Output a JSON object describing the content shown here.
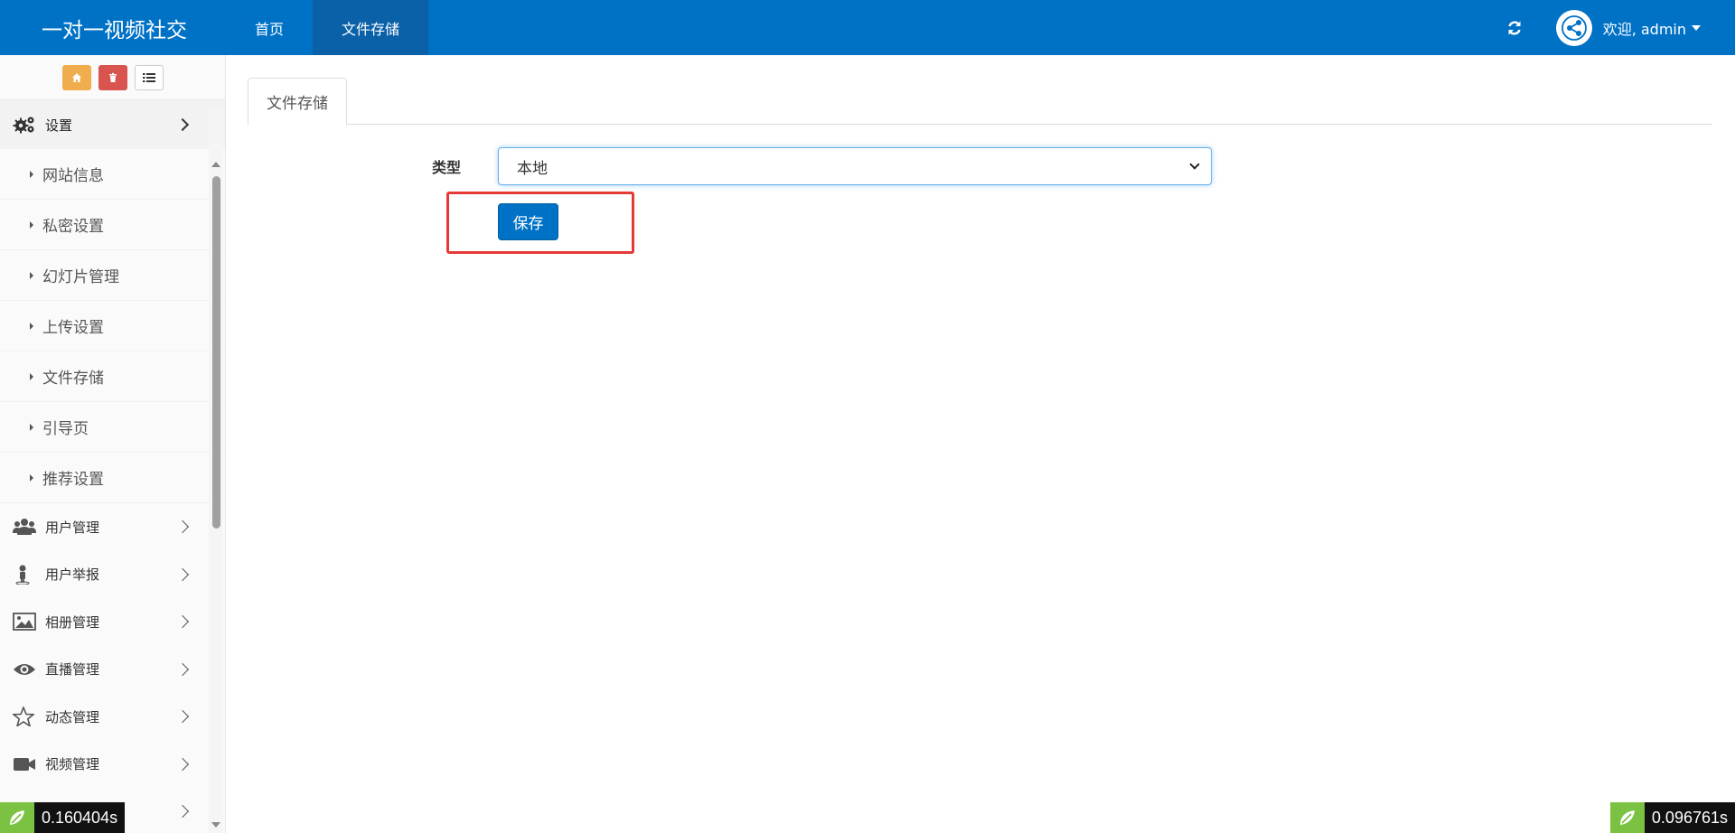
{
  "navbar": {
    "brand": "一对一视频社交",
    "tabs": [
      {
        "label": "首页",
        "active": false
      },
      {
        "label": "文件存储",
        "active": true
      }
    ],
    "refresh_icon": "refresh-icon",
    "user_avatar_icon": "share-network-icon",
    "user_greeting": "欢迎, admin",
    "color": "#0072c6"
  },
  "sidebar": {
    "shortcuts": [
      {
        "icon": "home-icon",
        "color": "#f0ad4e"
      },
      {
        "icon": "trash-icon",
        "color": "#d9534f"
      },
      {
        "icon": "list-icon",
        "color": "#ffffff"
      }
    ],
    "settings": {
      "label": "设置",
      "icon": "cogs-icon",
      "expanded": true,
      "children": [
        "网站信息",
        "私密设置",
        "幻灯片管理",
        "上传设置",
        "文件存储",
        "引导页",
        "推荐设置"
      ]
    },
    "menus": [
      {
        "label": "用户管理",
        "icon": "users-icon"
      },
      {
        "label": "用户举报",
        "icon": "user-report-icon"
      },
      {
        "label": "相册管理",
        "icon": "picture-icon"
      },
      {
        "label": "直播管理",
        "icon": "eye-icon"
      },
      {
        "label": "动态管理",
        "icon": "star-icon"
      },
      {
        "label": "视频管理",
        "icon": "video-camera-icon"
      },
      {
        "label": "",
        "icon": ""
      }
    ]
  },
  "main": {
    "tab_label": "文件存储",
    "form": {
      "type_label": "类型",
      "type_value": "本地",
      "save_label": "保存"
    },
    "highlight_color": "#e53935"
  },
  "timers": {
    "left": "0.160404s",
    "right": "0.096761s"
  }
}
